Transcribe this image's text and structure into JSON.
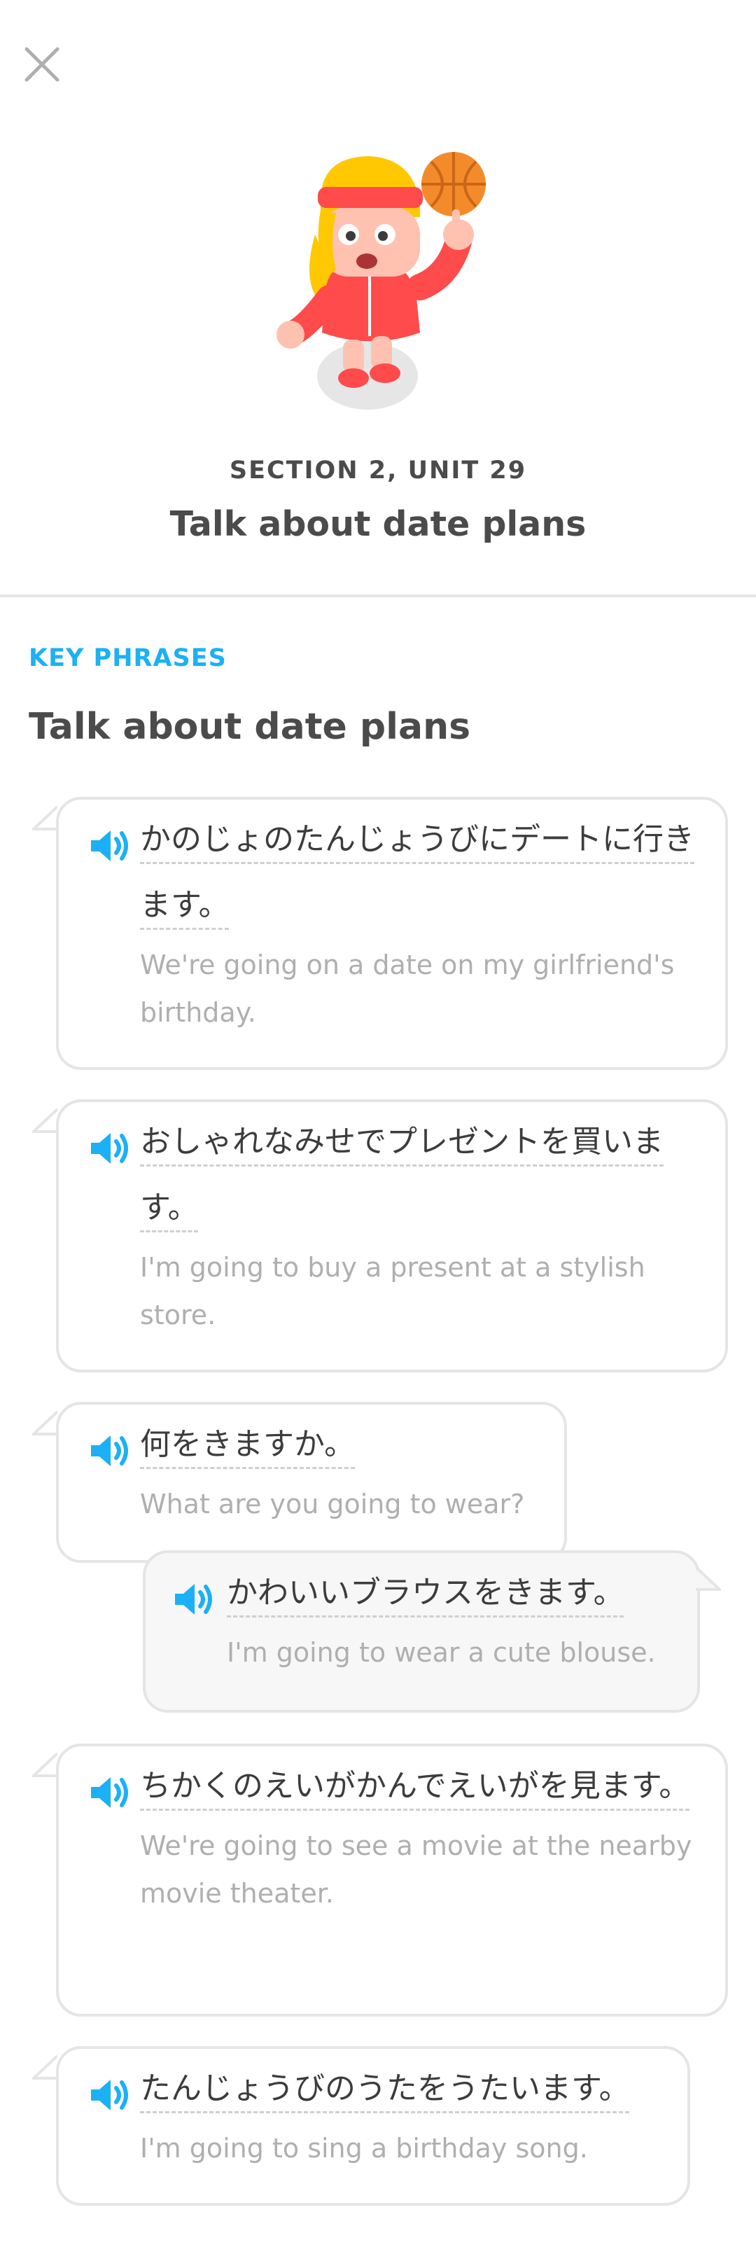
{
  "header": {
    "close_icon": "close-icon",
    "character": "duo-character-with-basketball",
    "section_label": "SECTION 2, UNIT 29",
    "unit_title": "Talk about date plans"
  },
  "key_phrases": {
    "label": "KEY PHRASES",
    "title": "Talk about date plans",
    "items": [
      {
        "jp": "かのじょのたんじょうびにデートに行きます。",
        "en": "We're going on a date on my girlfriend's birthday.",
        "side": "left"
      },
      {
        "jp": "おしゃれなみせでプレゼントを買います。",
        "en": "I'm going to buy a present at a stylish store.",
        "side": "left"
      },
      {
        "jp": "何をきますか。",
        "en": "What are you going to wear?",
        "side": "left"
      },
      {
        "jp": "かわいいブラウスをきます。",
        "en": "I'm going to wear a cute blouse.",
        "side": "right"
      },
      {
        "jp": "ちかくのえいがかんでえいがを見ます。",
        "en": "We're going to see a movie at the nearby movie theater.",
        "side": "left"
      },
      {
        "jp": "たんじょうびのうたをうたいます。",
        "en": "I'm going to sing a birthday song.",
        "side": "left"
      }
    ]
  },
  "colors": {
    "accent": "#1cb0f6",
    "text": "#4b4b4b",
    "muted": "#afafaf",
    "border": "#e5e5e5"
  }
}
